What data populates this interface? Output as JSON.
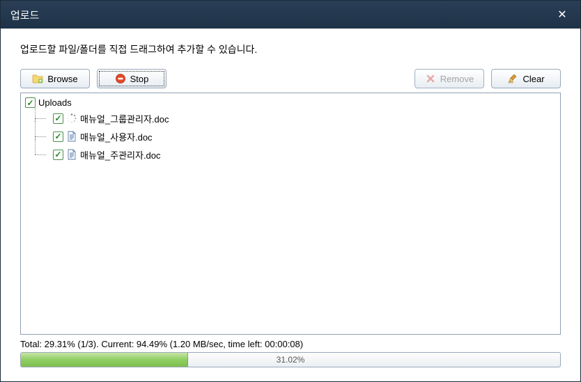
{
  "window": {
    "title": "업로드"
  },
  "instruction": "업로드할 파일/폴더를 직접 드래그하여 추가할 수 있습니다.",
  "toolbar": {
    "browse_label": "Browse",
    "stop_label": "Stop",
    "remove_label": "Remove",
    "clear_label": "Clear"
  },
  "tree": {
    "root_label": "Uploads",
    "items": [
      {
        "name": "매뉴얼_그룹관리자.doc",
        "icon": "loading"
      },
      {
        "name": "매뉴얼_사용자.doc",
        "icon": "doc"
      },
      {
        "name": "매뉴얼_주관리자.doc",
        "icon": "doc"
      }
    ]
  },
  "status": {
    "text": "Total: 29.31% (1/3). Current: 94.49% (1.20 MB/sec, time left: 00:00:08)",
    "progress_percent": 31.02,
    "progress_label": "31.02%"
  }
}
